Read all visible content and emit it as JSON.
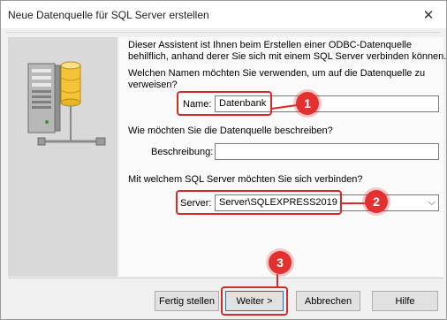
{
  "window": {
    "title": "Neue Datenquelle für SQL Server erstellen"
  },
  "intro": {
    "line1": "Dieser Assistent ist Ihnen beim Erstellen einer ODBC-Datenquelle",
    "line2": "behilflich, anhand derer Sie sich mit einem SQL Server verbinden können."
  },
  "name_section": {
    "question_line1": "Welchen Namen möchten Sie verwenden, um auf die Datenquelle zu",
    "question_line2": "verweisen?",
    "label": "Name:",
    "value": "Datenbank"
  },
  "description_section": {
    "question": "Wie möchten Sie die Datenquelle beschreiben?",
    "label": "Beschreibung:",
    "value": ""
  },
  "server_section": {
    "question": "Mit welchem SQL Server möchten Sie sich verbinden?",
    "label": "Server:",
    "value": "Server\\SQLEXPRESS2019"
  },
  "annotations": {
    "marker1": "1",
    "marker2": "2",
    "marker3": "3",
    "color": "#e53030"
  },
  "buttons": {
    "finish": "Fertig stellen",
    "next": "Weiter >",
    "cancel": "Abbrechen",
    "help": "Hilfe"
  },
  "icons": {
    "close": "close-icon",
    "server": "server-database-icon",
    "dropdown": "chevron-down-icon"
  }
}
